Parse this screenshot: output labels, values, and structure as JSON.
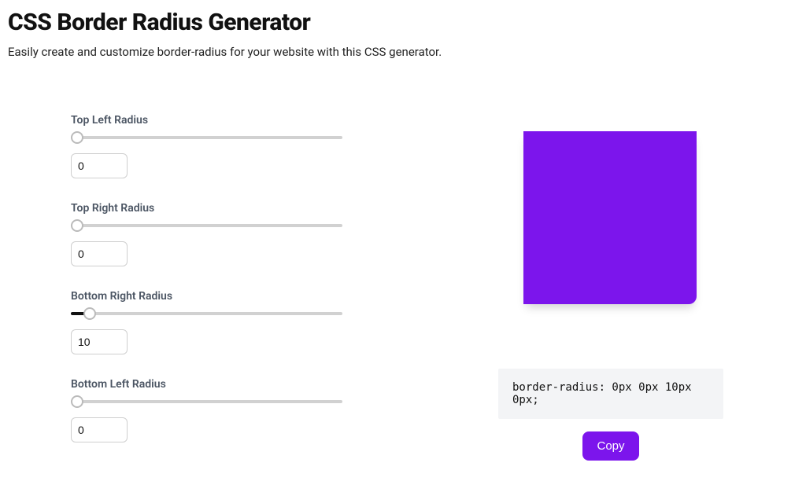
{
  "title": "CSS Border Radius Generator",
  "subtitle": "Easily create and customize border-radius for your website with this CSS generator.",
  "controls": {
    "top_left": {
      "label": "Top Left Radius",
      "value": "0"
    },
    "top_right": {
      "label": "Top Right Radius",
      "value": "0"
    },
    "bottom_right": {
      "label": "Bottom Right Radius",
      "value": "10"
    },
    "bottom_left": {
      "label": "Bottom Left Radius",
      "value": "0"
    }
  },
  "slider_max": "200",
  "preview": {
    "color": "#7c15ec",
    "border_radius_css": "0px 0px 10px 0px"
  },
  "code_output": "border-radius: 0px 0px 10px 0px;",
  "copy_button_label": "Copy"
}
